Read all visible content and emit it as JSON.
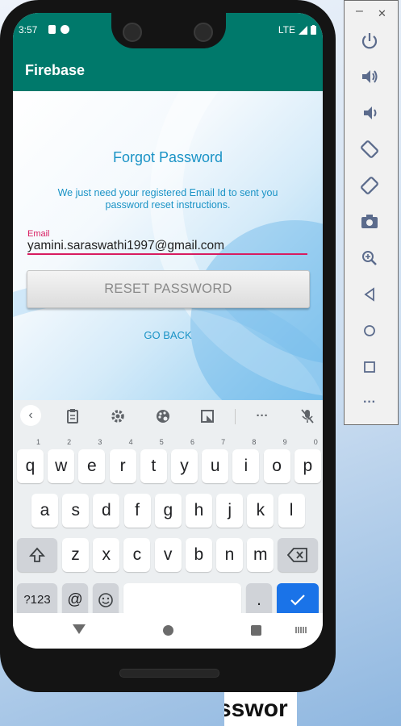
{
  "status_bar": {
    "time": "3:57",
    "network": "LTE"
  },
  "app_bar": {
    "title": "Firebase"
  },
  "form": {
    "title": "Forgot Password",
    "description": "We just need your registered Email Id to sent you password reset instructions.",
    "email_label": "Email",
    "email_value": "yamini.saraswathi1997@gmail.com",
    "reset_button": "RESET PASSWORD",
    "go_back": "GO BACK"
  },
  "keyboard": {
    "row1": [
      {
        "k": "q",
        "h": "1"
      },
      {
        "k": "w",
        "h": "2"
      },
      {
        "k": "e",
        "h": "3"
      },
      {
        "k": "r",
        "h": "4"
      },
      {
        "k": "t",
        "h": "5"
      },
      {
        "k": "y",
        "h": "6"
      },
      {
        "k": "u",
        "h": "7"
      },
      {
        "k": "i",
        "h": "8"
      },
      {
        "k": "o",
        "h": "9"
      },
      {
        "k": "p",
        "h": "0"
      }
    ],
    "row2": [
      "a",
      "s",
      "d",
      "f",
      "g",
      "h",
      "j",
      "k",
      "l"
    ],
    "row3": [
      "z",
      "x",
      "c",
      "v",
      "b",
      "n",
      "m"
    ],
    "symbols_key": "?123",
    "at_key": "@",
    "period_key": "."
  },
  "background_text": "sswor",
  "icons": {
    "status": [
      "sim-icon",
      "app-notification-icon",
      "signal-icon",
      "battery-icon"
    ],
    "toolbar": [
      "back-chevron-icon",
      "clipboard-icon",
      "settings-icon",
      "palette-icon",
      "resize-icon",
      "more-icon",
      "mic-off-icon"
    ],
    "emulator": [
      "power-icon",
      "volume-up-icon",
      "volume-down-icon",
      "rotate-left-icon",
      "rotate-right-icon",
      "camera-icon",
      "zoom-icon",
      "back-icon",
      "home-icon",
      "overview-icon",
      "more-icon"
    ]
  },
  "colors": {
    "primary": "#00796b",
    "accent": "#d81b60",
    "link": "#1a93c6",
    "enter": "#1a73e8"
  }
}
